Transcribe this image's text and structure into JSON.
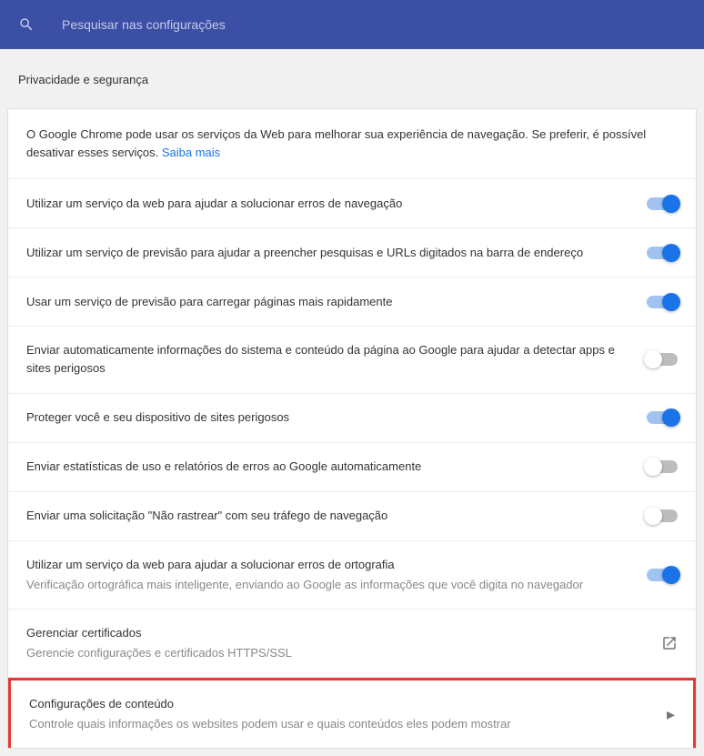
{
  "search": {
    "placeholder": "Pesquisar nas configurações"
  },
  "section_title": "Privacidade e segurança",
  "intro": {
    "text": "O Google Chrome pode usar os serviços da Web para melhorar sua experiência de navegação. Se preferir, é possível desativar esses serviços. ",
    "link": "Saiba mais"
  },
  "rows": {
    "nav_errors": {
      "title": "Utilizar um serviço da web para ajudar a solucionar erros de navegação"
    },
    "prediction": {
      "title": "Utilizar um serviço de previsão para ajudar a preencher pesquisas e URLs digitados na barra de endereço"
    },
    "preload": {
      "title": "Usar um serviço de previsão para carregar páginas mais rapidamente"
    },
    "auto_send": {
      "title": "Enviar automaticamente informações do sistema e conteúdo da página ao Google para ajudar a detectar apps e sites perigosos"
    },
    "protect": {
      "title": "Proteger você e seu dispositivo de sites perigosos"
    },
    "usage_stats": {
      "title": "Enviar estatísticas de uso e relatórios de erros ao Google automaticamente"
    },
    "dnt": {
      "title": "Enviar uma solicitação \"Não rastrear\" com seu tráfego de navegação"
    },
    "spellcheck": {
      "title": "Utilizar um serviço da web para ajudar a solucionar erros de ortografia",
      "subtitle": "Verificação ortográfica mais inteligente, enviando ao Google as informações que você digita no navegador"
    },
    "certificates": {
      "title": "Gerenciar certificados",
      "subtitle": "Gerencie configurações e certificados HTTPS/SSL"
    },
    "content_settings": {
      "title": "Configurações de conteúdo",
      "subtitle": "Controle quais informações os websites podem usar e quais conteúdos eles podem mostrar"
    }
  }
}
